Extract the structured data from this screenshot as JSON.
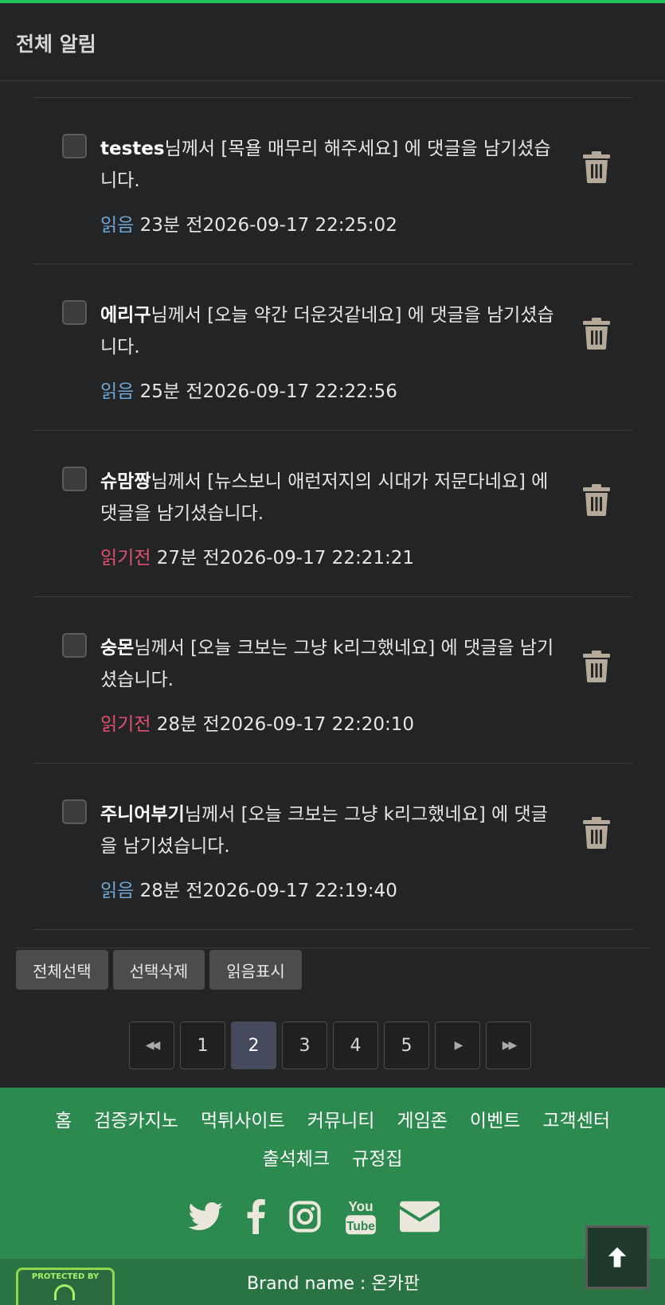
{
  "header": {
    "title": "전체 알림"
  },
  "notifications": [
    {
      "nick": "testes",
      "text": "님께서 [목욜 매무리 해주세요] 에 댓글을 남기셨습니다.",
      "status": "읽음",
      "status_type": "read",
      "ago": "23분 전",
      "datetime": "2026-09-17 22:25:02"
    },
    {
      "nick": "에리구",
      "text": "님께서 [오늘 약간 더운것같네요] 에 댓글을 남기셨습니다.",
      "status": "읽음",
      "status_type": "read",
      "ago": "25분 전",
      "datetime": "2026-09-17 22:22:56"
    },
    {
      "nick": "슈맘짱",
      "text": "님께서 [뉴스보니 애런저지의 시대가 저문다네요] 에 댓글을 남기셨습니다.",
      "status": "읽기전",
      "status_type": "unread",
      "ago": "27분 전",
      "datetime": "2026-09-17 22:21:21"
    },
    {
      "nick": "숭몬",
      "text": "님께서 [오늘 크보는 그냥 k리그했네요] 에 댓글을 남기셨습니다.",
      "status": "읽기전",
      "status_type": "unread",
      "ago": "28분 전",
      "datetime": "2026-09-17 22:20:10"
    },
    {
      "nick": "주니어부기",
      "text": "님께서 [오늘 크보는 그냥 k리그했네요] 에 댓글을 남기셨습니다.",
      "status": "읽음",
      "status_type": "read",
      "ago": "28분 전",
      "datetime": "2026-09-17 22:19:40"
    }
  ],
  "actions": {
    "select_all": "전체선택",
    "delete_selected": "선택삭제",
    "mark_read": "읽음표시"
  },
  "pagination": {
    "pages": [
      "1",
      "2",
      "3",
      "4",
      "5"
    ],
    "current": "2"
  },
  "footer": {
    "links": [
      "홈",
      "검증카지노",
      "먹튀사이트",
      "커뮤니티",
      "게임존",
      "이벤트",
      "고객센터",
      "출석체크",
      "규정집"
    ],
    "social": [
      "twitter-icon",
      "facebook-icon",
      "instagram-icon",
      "youtube-icon",
      "mail-icon"
    ],
    "badge": "PROTECTED BY",
    "brand": "Brand name : 온카판"
  },
  "colors": {
    "accent_top": "#21c25a",
    "footer_bg": "#2c8a4e",
    "read": "#6fa8d6",
    "unread": "#e2506e",
    "active_page": "#454a5e"
  }
}
